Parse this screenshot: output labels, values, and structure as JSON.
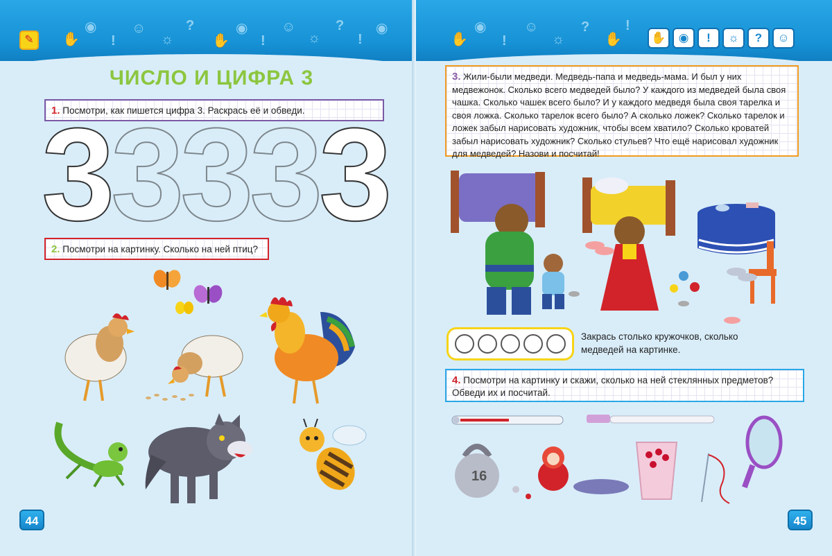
{
  "left_page": {
    "title": "ЧИСЛО И ЦИФРА 3",
    "task1": {
      "num": "1.",
      "text": "Посмотри, как пишется цифра 3. Раскрась её и обведи."
    },
    "digits": [
      "3",
      "3",
      "3",
      "3",
      "3"
    ],
    "task2": {
      "num": "2.",
      "text": "Посмотри на картинку. Сколько на ней птиц?"
    },
    "page_number": "44",
    "logo_glyph": "✎"
  },
  "right_page": {
    "task3": {
      "num": "3.",
      "text": "Жили-были медведи. Медведь-папа и медведь-мама. И был у них медвежонок. Сколько всего медведей было? У каждого из медведей была своя чашка. Сколько чашек всего было? И у каждого медведя была своя тарелка и своя ложка. Сколько тарелок всего было? А сколько ложек? Сколько тарелок и ложек забыл нарисовать художник, чтобы всем хватило? Сколько кроватей забыл нарисовать художник? Сколько стульев? Что ещё нарисовал художник для медведей? Назови и посчитай!"
    },
    "color_instruction": "Закрась столько кружочков, сколько медведей на картинке.",
    "task4": {
      "num": "4.",
      "text": "Посмотри на картинку и скажи, сколько на ней стеклянных предметов? Обведи их и посчитай."
    },
    "kettlebell_label": "16",
    "page_number": "45",
    "header_icons": [
      "hand-icon",
      "eye-icon",
      "exclamation-icon",
      "sun-icon",
      "question-icon",
      "thinking-person-icon"
    ],
    "header_glyphs": [
      "✋",
      "◉",
      "!",
      "☼",
      "?",
      "☺"
    ]
  },
  "colors": {
    "header_blue": "#1792d6",
    "title_green": "#8cc63f",
    "task1_border": "#7b5aa6",
    "task2_border": "#d2232a",
    "task3_border": "#f39a20",
    "task4_border": "#29a7e6",
    "page_bg": "#d9edf9"
  }
}
